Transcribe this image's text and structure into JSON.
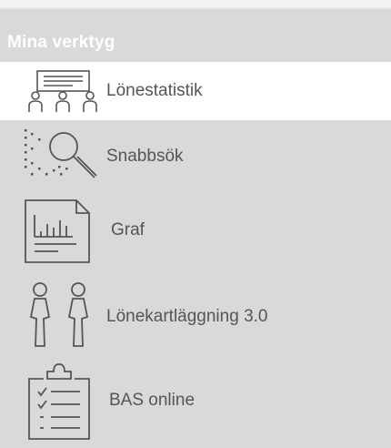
{
  "menu": {
    "header": "Mina verktyg",
    "items": [
      {
        "label": "Lönestatistik",
        "icon": "presentation-audience-icon",
        "active": true
      },
      {
        "label": "Snabbsök",
        "icon": "magnifier-search-icon",
        "active": false
      },
      {
        "label": "Graf",
        "icon": "bar-chart-document-icon",
        "active": false
      },
      {
        "label": "Lönekartläggning 3.0",
        "icon": "male-female-figures-icon",
        "active": false
      },
      {
        "label": "BAS online",
        "icon": "clipboard-checklist-icon",
        "active": false
      }
    ]
  },
  "colors": {
    "panel": "#d9d9d9",
    "active": "#ffffff",
    "text": "#555555",
    "header_text": "#ffffff"
  }
}
